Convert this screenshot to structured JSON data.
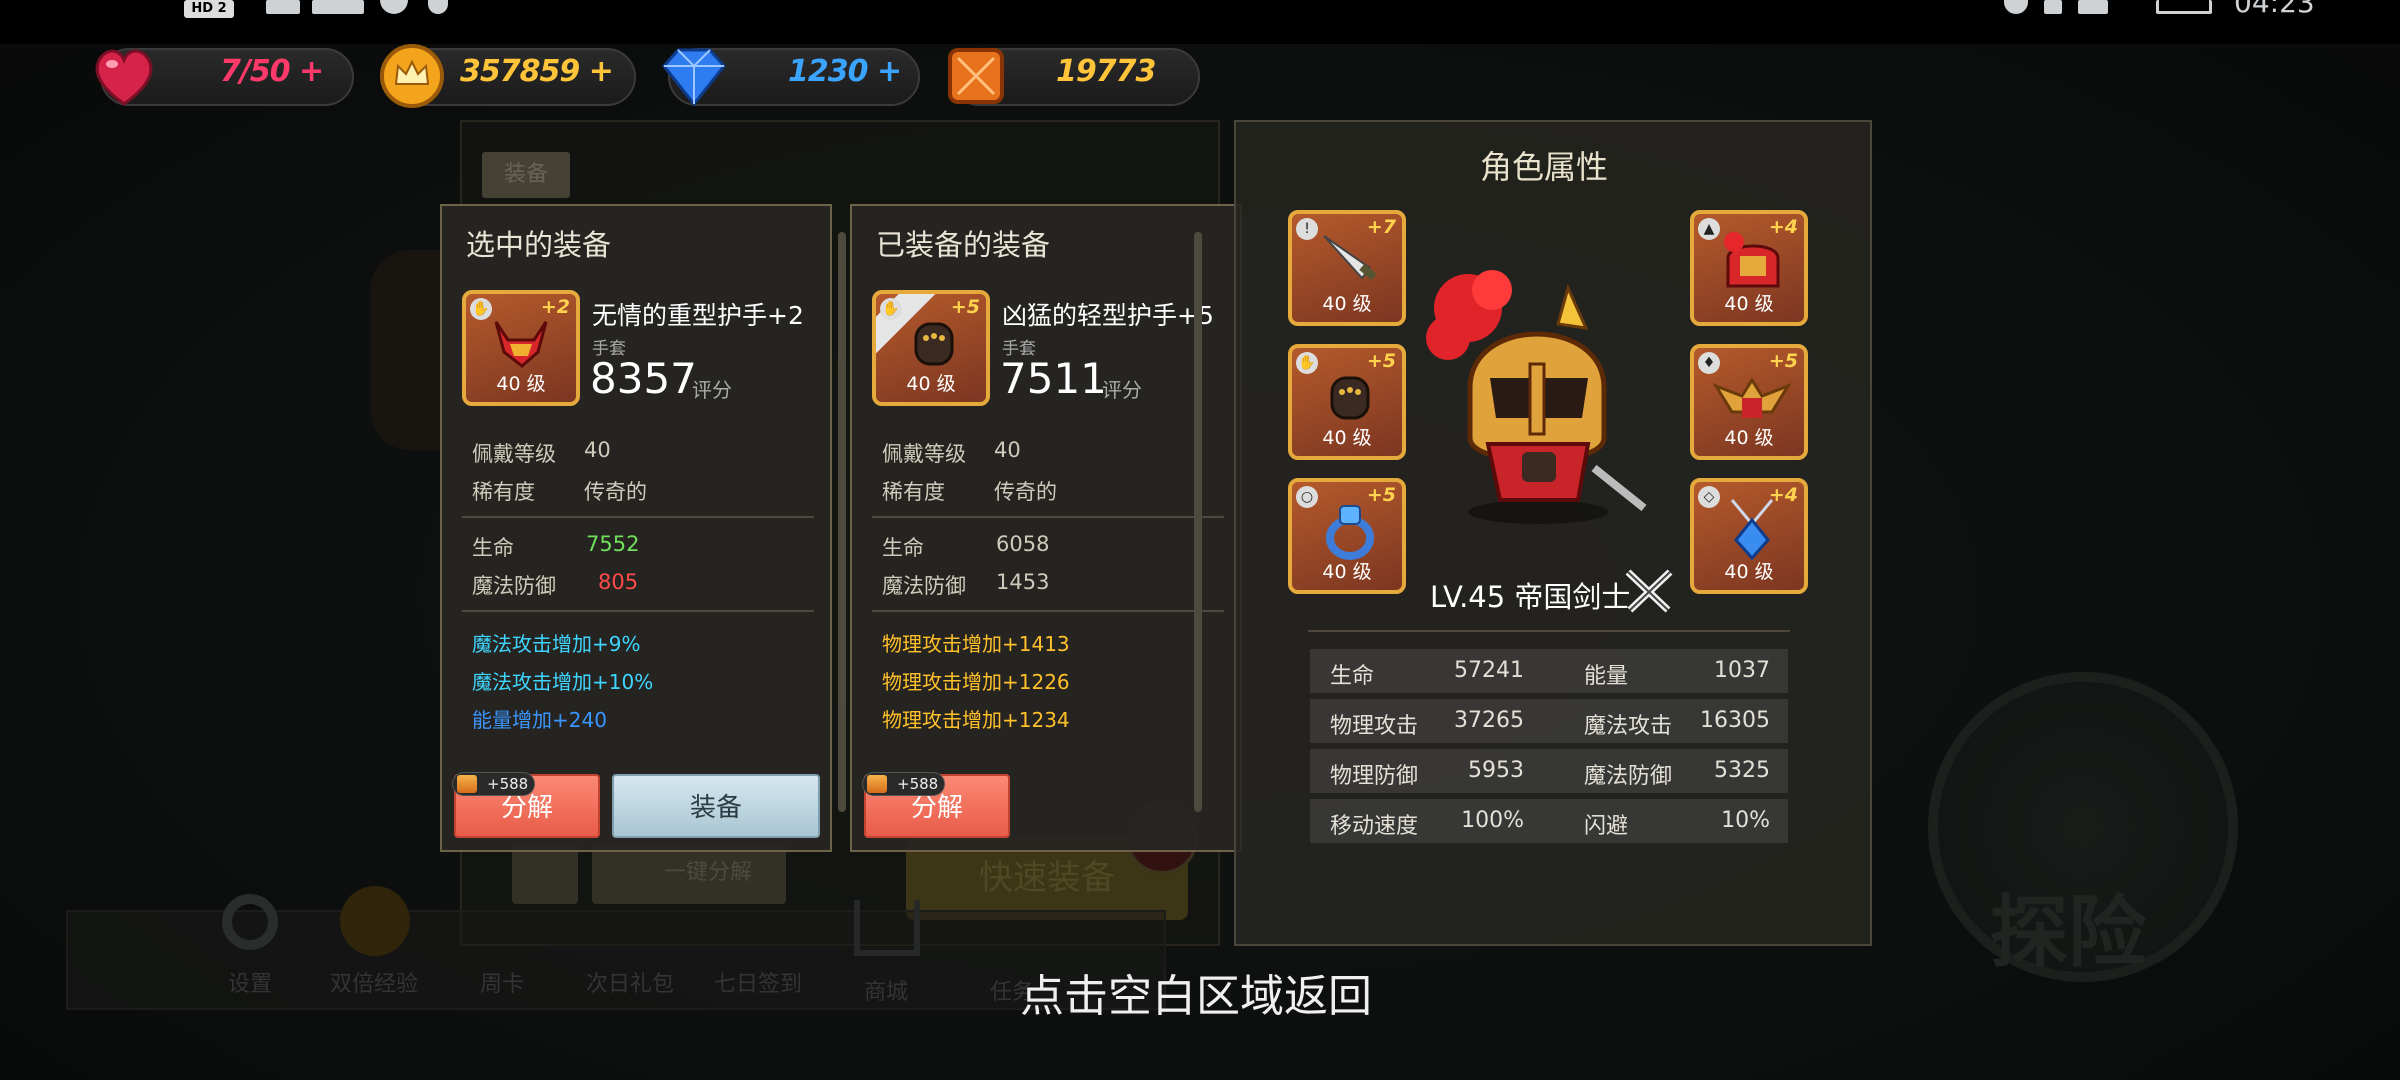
{
  "status_bar": {
    "left_badge": "HD 2",
    "time": "04:23"
  },
  "resources": [
    {
      "name": "energy",
      "icon": "heart-icon",
      "value": "7/50",
      "plus": "+",
      "color": "#ff3a6b"
    },
    {
      "name": "gold",
      "icon": "crown-coin-icon",
      "value": "357859",
      "plus": "+",
      "color": "#ffc43a"
    },
    {
      "name": "gems",
      "icon": "diamond-icon",
      "value": "1230",
      "plus": "+",
      "color": "#3aa4ff"
    },
    {
      "name": "material",
      "icon": "orange-crystal-icon",
      "value": "19773",
      "plus": "",
      "color": "#ffc43a"
    }
  ],
  "background_ui": {
    "equipment_tab": "装备",
    "one_click_decompose": "一键分解",
    "quick_equip": "快速装备",
    "bottom_menu": [
      "设置",
      "双倍经验",
      "周卡",
      "次日礼包",
      "七日签到",
      "商城",
      "任务"
    ],
    "explore": "探险"
  },
  "selected": {
    "title": "选中的装备",
    "name": "无情的重型护手+2",
    "type": "手套",
    "score": "8357",
    "score_label": "评分",
    "level_badge": "40 级",
    "plus": "+2",
    "wear_level_label": "佩戴等级",
    "wear_level": "40",
    "rarity_label": "稀有度",
    "rarity": "传奇的",
    "stats": [
      {
        "k": "生命",
        "v": "7552",
        "color": "#6fe05a"
      },
      {
        "k": "魔法防御",
        "v": "805",
        "color": "#ff4a4a"
      }
    ],
    "bonuses": [
      {
        "text": "魔法攻击增加+9%",
        "color": "#3ed6ff"
      },
      {
        "text": "魔法攻击增加+10%",
        "color": "#3ed6ff"
      },
      {
        "text": "能量增加+240",
        "color": "#3a96ff"
      }
    ],
    "cost": "+588",
    "decompose": "分解",
    "equip": "装备"
  },
  "equipped": {
    "title": "已装备的装备",
    "name": "凶猛的轻型护手+5",
    "type": "手套",
    "score": "7511",
    "score_label": "评分",
    "level_badge": "40 级",
    "plus": "+5",
    "wear_level_label": "佩戴等级",
    "wear_level": "40",
    "rarity_label": "稀有度",
    "rarity": "传奇的",
    "stats": [
      {
        "k": "生命",
        "v": "6058",
        "color": "#cfcabb"
      },
      {
        "k": "魔法防御",
        "v": "1453",
        "color": "#cfcabb"
      }
    ],
    "bonuses": [
      {
        "text": "物理攻击增加+1413",
        "color": "#ffc02a"
      },
      {
        "text": "物理攻击增加+1226",
        "color": "#ffc02a"
      },
      {
        "text": "物理攻击增加+1234",
        "color": "#ffc02a"
      }
    ],
    "cost": "+588",
    "decompose": "分解"
  },
  "character": {
    "title": "角色属性",
    "level_name": "LV.45 帝国剑士",
    "slots_left": [
      {
        "plus": "+7",
        "level": "40 级",
        "icon": "sword-icon"
      },
      {
        "plus": "+5",
        "level": "40 级",
        "icon": "gauntlet-icon"
      },
      {
        "plus": "+5",
        "level": "40 级",
        "icon": "ring-icon"
      }
    ],
    "slots_right": [
      {
        "plus": "+4",
        "level": "40 级",
        "icon": "helmet-icon"
      },
      {
        "plus": "+5",
        "level": "40 级",
        "icon": "shoulder-armor-icon"
      },
      {
        "plus": "+4",
        "level": "40 级",
        "icon": "amulet-icon"
      }
    ],
    "attributes": [
      {
        "k1": "生命",
        "v1": "57241",
        "k2": "能量",
        "v2": "1037"
      },
      {
        "k1": "物理攻击",
        "v1": "37265",
        "k2": "魔法攻击",
        "v2": "16305"
      },
      {
        "k1": "物理防御",
        "v1": "5953",
        "k2": "魔法防御",
        "v2": "5325"
      },
      {
        "k1": "移动速度",
        "v1": "100%",
        "k2": "闪避",
        "v2": "10%"
      }
    ]
  },
  "hint": "点击空白区域返回"
}
